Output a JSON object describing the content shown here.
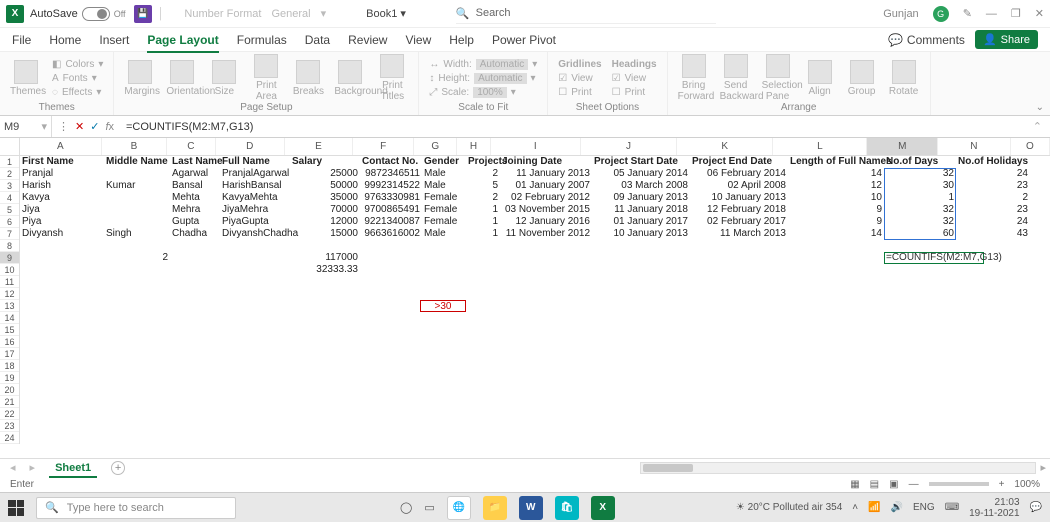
{
  "title": {
    "autosave": "AutoSave",
    "autosave_state": "Off",
    "numfmt_label": "Number Format",
    "numfmt_value": "General",
    "book": "Book1",
    "search_placeholder": "Search",
    "user": "Gunjan",
    "user_initial": "G"
  },
  "menu": {
    "tabs": [
      "File",
      "Home",
      "Insert",
      "Page Layout",
      "Formulas",
      "Data",
      "Review",
      "View",
      "Help",
      "Power Pivot"
    ],
    "comments": "Comments",
    "share": "Share"
  },
  "ribbon": {
    "themes": {
      "btn": "Themes",
      "colors": "Colors",
      "fonts": "Fonts",
      "effects": "Effects",
      "label": "Themes"
    },
    "pagesetup": {
      "margins": "Margins",
      "orient": "Orientation",
      "size": "Size",
      "printarea": "Print\nArea",
      "breaks": "Breaks",
      "bg": "Background",
      "titles": "Print\nTitles",
      "label": "Page Setup"
    },
    "scale": {
      "width": "Width:",
      "wval": "Automatic",
      "height": "Height:",
      "hval": "Automatic",
      "scale": "Scale:",
      "sval": "100%",
      "label": "Scale to Fit"
    },
    "sheet": {
      "gridlines": "Gridlines",
      "headings": "Headings",
      "view": "View",
      "print": "Print",
      "label": "Sheet Options"
    },
    "arrange": {
      "bring": "Bring\nForward",
      "send": "Send\nBackward",
      "pane": "Selection\nPane",
      "align": "Align",
      "group": "Group",
      "rotate": "Rotate",
      "label": "Arrange"
    }
  },
  "fb": {
    "ref": "M9",
    "formula": "=COUNTIFS(M2:M7,G13)",
    "editing": "=COUNTIFS(M2:M7,G13)"
  },
  "cols": [
    "",
    "A",
    "B",
    "C",
    "D",
    "E",
    "F",
    "G",
    "H",
    "I",
    "J",
    "K",
    "L",
    "M",
    "N",
    "O"
  ],
  "headers": {
    "A": "First Name",
    "B": "Middle Name",
    "C": "Last Name",
    "D": "Full Name",
    "E": "Salary",
    "F": "Contact No.",
    "G": "Gender",
    "H": "Projects",
    "I": "Joining Date",
    "J": "Project Start Date",
    "K": "Project End Date",
    "L": "Length of Full Names",
    "M": "No.of Days",
    "N": "No.of Holidays"
  },
  "rows": [
    {
      "A": "Pranjal",
      "B": "",
      "C": "Agarwal",
      "D": "PranjalAgarwal",
      "E": "25000",
      "F": "9872346511",
      "G": "Male",
      "H": "2",
      "I": "11 January 2013",
      "J": "05 January 2014",
      "K": "06 February 2014",
      "L": "14",
      "M": "32",
      "N": "24"
    },
    {
      "A": "Harish",
      "B": "Kumar",
      "C": "Bansal",
      "D": "HarishBansal",
      "E": "50000",
      "F": "9992314522",
      "G": "Male",
      "H": "5",
      "I": "01 January 2007",
      "J": "03 March 2008",
      "K": "02 April 2008",
      "L": "12",
      "M": "30",
      "N": "23"
    },
    {
      "A": "Kavya",
      "B": "",
      "C": "Mehta",
      "D": "KavyaMehta",
      "E": "35000",
      "F": "9763330981",
      "G": "Female",
      "H": "2",
      "I": "02 February 2012",
      "J": "09 January 2013",
      "K": "10 January 2013",
      "L": "10",
      "M": "1",
      "N": "2"
    },
    {
      "A": "Jiya",
      "B": "",
      "C": "Mehra",
      "D": "JiyaMehra",
      "E": "70000",
      "F": "9700865491",
      "G": "Female",
      "H": "1",
      "I": "03 November 2015",
      "J": "11 January 2018",
      "K": "12 February 2018",
      "L": "9",
      "M": "32",
      "N": "23"
    },
    {
      "A": "Piya",
      "B": "",
      "C": "Gupta",
      "D": "PiyaGupta",
      "E": "12000",
      "F": "9221340087",
      "G": "Female",
      "H": "1",
      "I": "12 January 2016",
      "J": "01 January 2017",
      "K": "02 February 2017",
      "L": "9",
      "M": "32",
      "N": "24"
    },
    {
      "A": "Divyansh",
      "B": "Singh",
      "C": "Chadha",
      "D": "DivyanshChadha",
      "E": "15000",
      "F": "9663616002",
      "G": "Male",
      "H": "1",
      "I": "11 November 2012",
      "J": "10 January 2013",
      "K": "11 March 2013",
      "L": "14",
      "M": "60",
      "N": "43"
    }
  ],
  "totals": {
    "B9": "2",
    "E9": "117000",
    "E10": "32333.33"
  },
  "crit": {
    "G13": ">30"
  },
  "sheet": {
    "name": "Sheet1",
    "status": "Enter",
    "zoom": "100%"
  },
  "tray": {
    "weather": "20°C  Polluted air 354",
    "lang": "ENG",
    "time": "21:03",
    "date": "19-11-2021"
  },
  "search_task": {
    "placeholder": "Type here to search"
  }
}
